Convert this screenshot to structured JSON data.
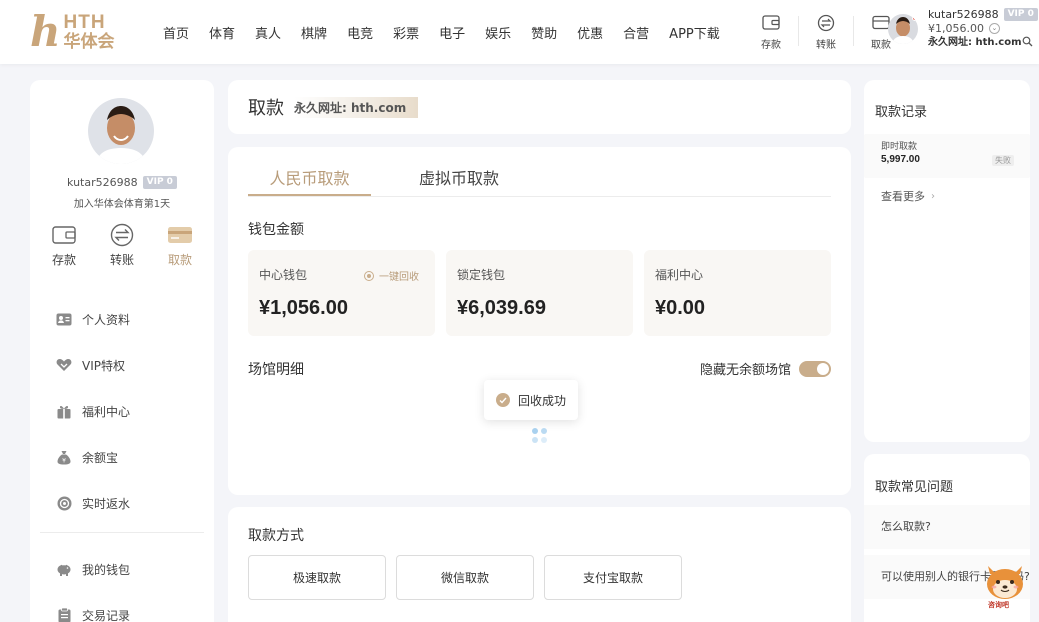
{
  "header": {
    "logo_mark": "h",
    "logo_en": "HTH",
    "logo_cn": "华体会",
    "nav": [
      "首页",
      "体育",
      "真人",
      "棋牌",
      "电竞",
      "彩票",
      "电子",
      "娱乐",
      "赞助",
      "优惠",
      "合营",
      "APP下载"
    ],
    "actions": [
      {
        "label": "存款",
        "icon": "wallet-icon"
      },
      {
        "label": "转账",
        "icon": "transfer-icon"
      },
      {
        "label": "取款",
        "icon": "card-icon"
      }
    ],
    "user": {
      "username": "kutar526988",
      "vip": "VIP 0",
      "balance": "¥1,056.00",
      "url_label": "永久网址: hth.com"
    }
  },
  "sidebar": {
    "username": "kutar526988",
    "vip": "VIP 0",
    "join_text": "加入华体会体育第1天",
    "quick": [
      {
        "label": "存款",
        "icon": "wallet-icon"
      },
      {
        "label": "转账",
        "icon": "transfer-icon"
      },
      {
        "label": "取款",
        "icon": "card-icon"
      }
    ],
    "menu": [
      {
        "label": "个人资料",
        "icon": "profile-card-icon"
      },
      {
        "label": "VIP特权",
        "icon": "vip-heart-icon"
      },
      {
        "label": "福利中心",
        "icon": "gift-icon"
      },
      {
        "label": "余额宝",
        "icon": "money-bag-icon"
      },
      {
        "label": "实时返水",
        "icon": "rebate-icon"
      }
    ],
    "menu2": [
      {
        "label": "我的钱包",
        "icon": "piggy-bank-icon"
      },
      {
        "label": "交易记录",
        "icon": "record-icon"
      }
    ]
  },
  "main": {
    "title": "取款",
    "title_url": "永久网址: hth.com",
    "tabs": [
      "人民币取款",
      "虚拟币取款"
    ],
    "wallet_label": "钱包金额",
    "wallets": [
      {
        "label": "中心钱包",
        "value": "¥1,056.00",
        "action": "一键回收"
      },
      {
        "label": "锁定钱包",
        "value": "¥6,039.69"
      },
      {
        "label": "福利中心",
        "value": "¥0.00"
      }
    ],
    "venue_label": "场馆明细",
    "hide_empty_label": "隐藏无余额场馆",
    "toast": "回收成功",
    "method_label": "取款方式",
    "methods": [
      "极速取款",
      "微信取款",
      "支付宝取款"
    ]
  },
  "records": {
    "title": "取款记录",
    "item": {
      "type": "即时取款",
      "amount": "5,997.00",
      "status": "失败"
    },
    "more": "查看更多"
  },
  "faq": {
    "title": "取款常见问题",
    "items": [
      "怎么取款?",
      "可以使用别人的银行卡取款吗?"
    ]
  },
  "mascot_label": "咨询吧",
  "colors": {
    "accent": "#c9ad8b",
    "background": "#f4f5f9"
  }
}
